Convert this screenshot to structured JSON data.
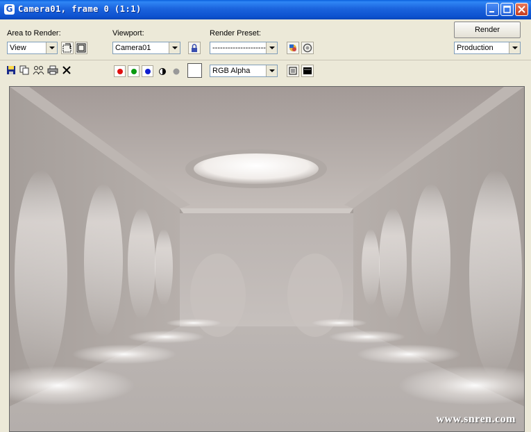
{
  "window": {
    "title": "Camera01, frame 0 (1:1)",
    "icon": "G"
  },
  "toolbar": {
    "area_label": "Area to Render:",
    "area_value": "View",
    "viewport_label": "Viewport:",
    "viewport_value": "Camera01",
    "preset_label": "Render Preset:",
    "preset_value": "-----------------------------",
    "render_label": "Render",
    "production_value": "Production",
    "channel_value": "RGB Alpha"
  },
  "colors": {
    "red_channel": "#e01010",
    "green_channel": "#0a9a10",
    "blue_channel": "#1020d0",
    "titlebar": "#1b63dd",
    "swatch": "#ffffff"
  },
  "icons": [
    "save-icon",
    "copy-icon",
    "clone-icon",
    "print-icon",
    "clear-icon",
    "region-icon",
    "crop-icon",
    "lock-icon",
    "environment-icon",
    "teapot-icon",
    "alpha-icon",
    "mono-icon",
    "display-icon",
    "toggle-icon"
  ],
  "watermark": "www.snren.com"
}
